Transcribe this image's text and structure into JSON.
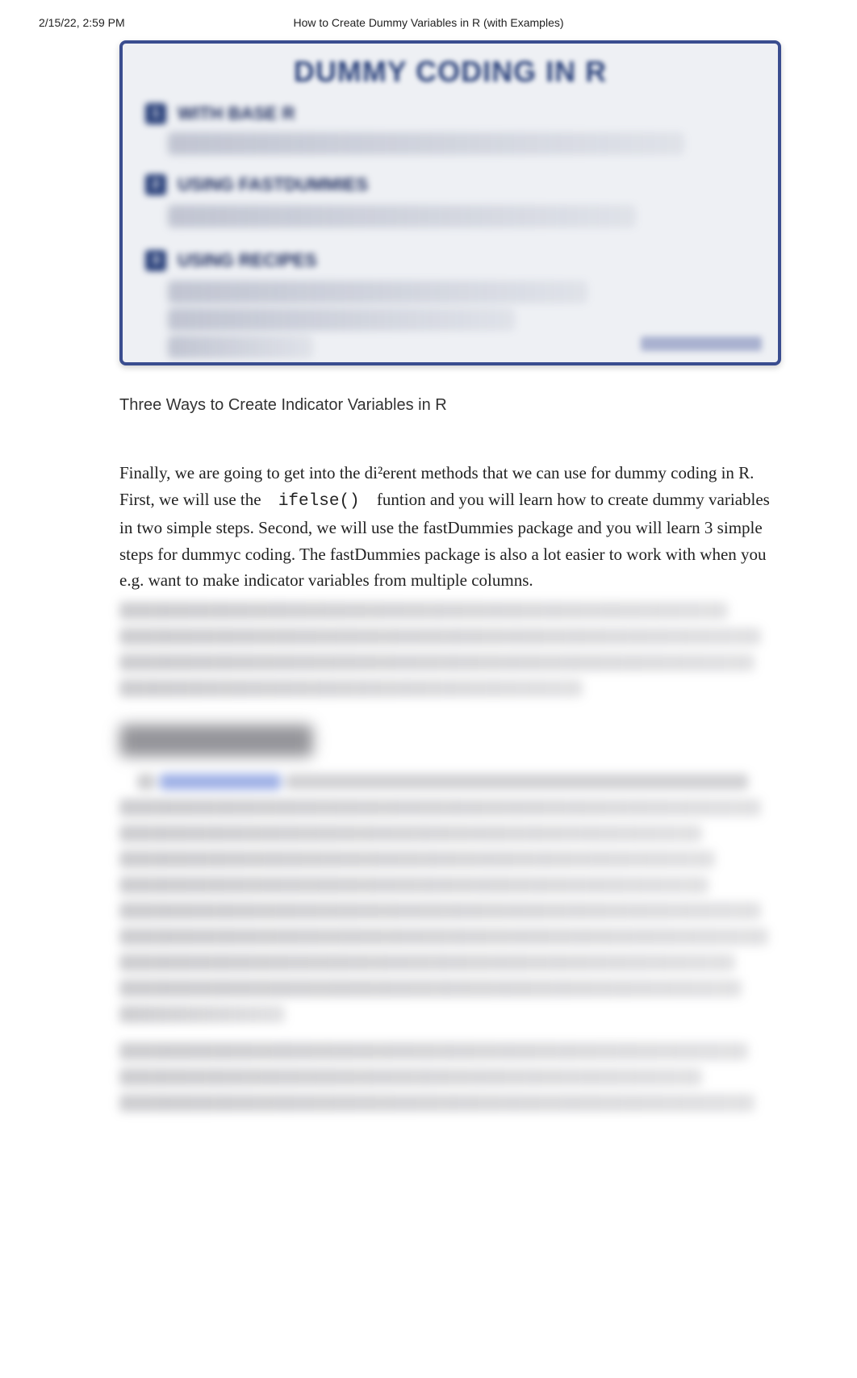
{
  "header": {
    "datetime": "2/15/22, 2:59 PM",
    "title": "How to Create Dummy Variables in R (with Examples)"
  },
  "figure": {
    "title": "DUMMY CODING IN R",
    "sections": [
      "WITH BASE R",
      "USING FASTDUMMIES",
      "USING RECIPES"
    ],
    "link_hint": "marsja.se"
  },
  "caption": "Three Ways to Create Indicator Variables in R",
  "paragraph": {
    "p1a": "Finally, we are going to get into the di²erent methods that we can use for dummy coding in R. First, we will use the ",
    "code": "ifelse()",
    "p1b": " funtion and you will learn how to create dummy variables in two simple steps. Second, we will use the fastDummies package and you will learn 3 simple steps for dummyc coding. The fastDummies package is also a lot easier to work with when you e.g. want to make indicator variables from multiple columns."
  },
  "blurred": {
    "heading": "Dummy Coding",
    "link_label": "regression analysis"
  }
}
